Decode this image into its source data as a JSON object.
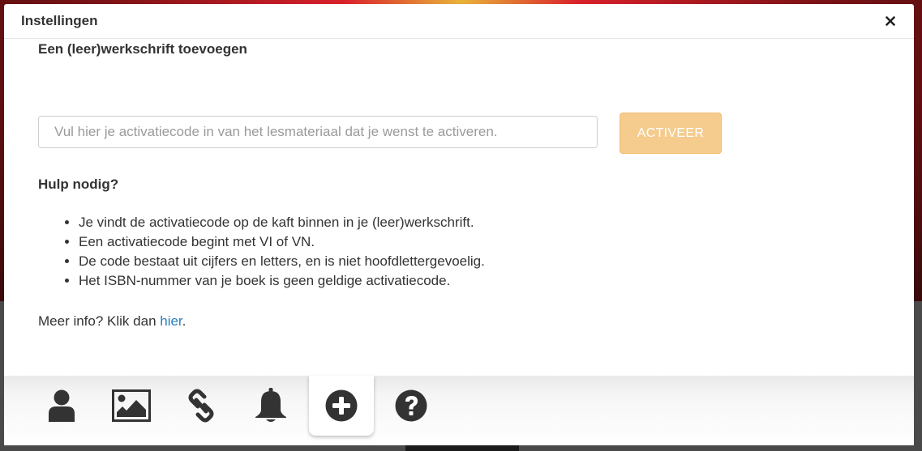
{
  "modal": {
    "title": "Instellingen",
    "close_label": "×"
  },
  "add_workbook": {
    "section_title": "Een (leer)werkschrift toevoegen",
    "input_value": "",
    "input_placeholder": "Vul hier je activatiecode in van het lesmateriaal dat je wenst te activeren.",
    "button_label": "ACTIVEER",
    "button_color": "#f5cc8e"
  },
  "help": {
    "title": "Hulp nodig?",
    "items": [
      "Je vindt de activatiecode op de kaft binnen in je (leer)werkschrift.",
      "Een activatiecode begint met VI of VN.",
      "De code bestaat uit cijfers en letters, en is niet hoofdlettergevoelig.",
      "Het ISBN-nummer van je boek is geen geldige activatiecode."
    ],
    "more_info_prefix": "Meer info? Klik dan ",
    "more_info_link": "hier",
    "more_info_suffix": ".",
    "link_color": "#2a7fc0"
  },
  "tabs": [
    {
      "icon": "user-icon",
      "active": false
    },
    {
      "icon": "image-icon",
      "active": false
    },
    {
      "icon": "link-icon",
      "active": false
    },
    {
      "icon": "bell-icon",
      "active": false
    },
    {
      "icon": "plus-circle-icon",
      "active": true
    },
    {
      "icon": "question-circle-icon",
      "active": false
    }
  ]
}
